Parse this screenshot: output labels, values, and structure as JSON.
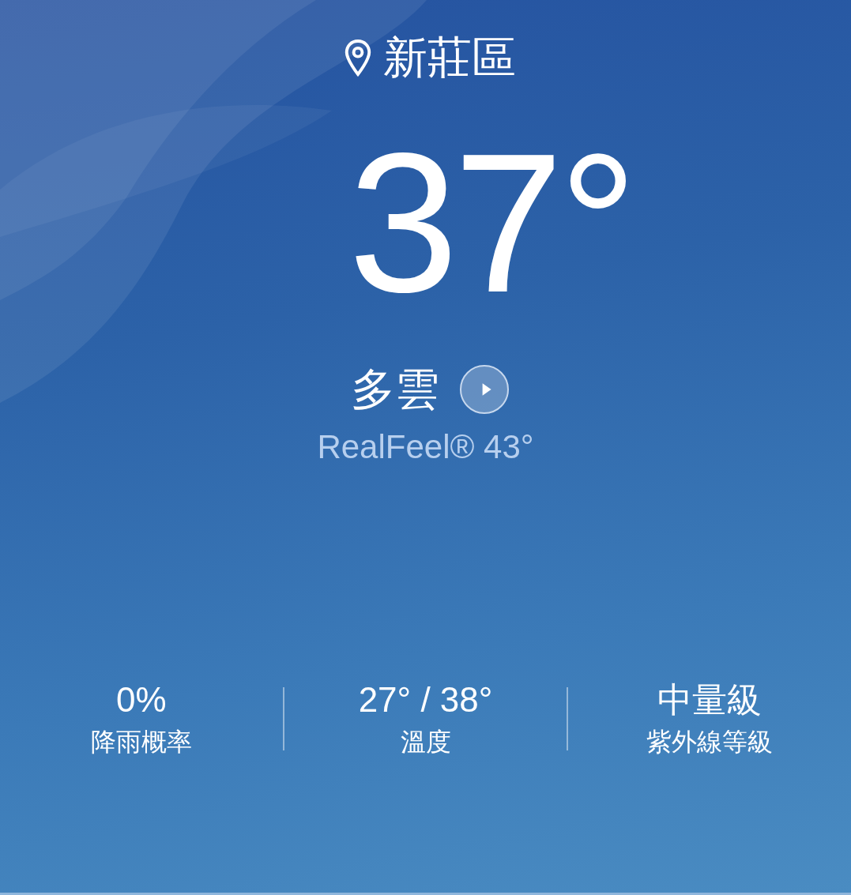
{
  "location": "新莊區",
  "temperature": "37°",
  "condition": "多雲",
  "realfeel": "RealFeel® 43°",
  "stats": [
    {
      "value": "0%",
      "label": "降雨概率"
    },
    {
      "value": "27° / 38°",
      "label": "溫度"
    },
    {
      "value": "中量級",
      "label": "紫外線等級"
    }
  ]
}
